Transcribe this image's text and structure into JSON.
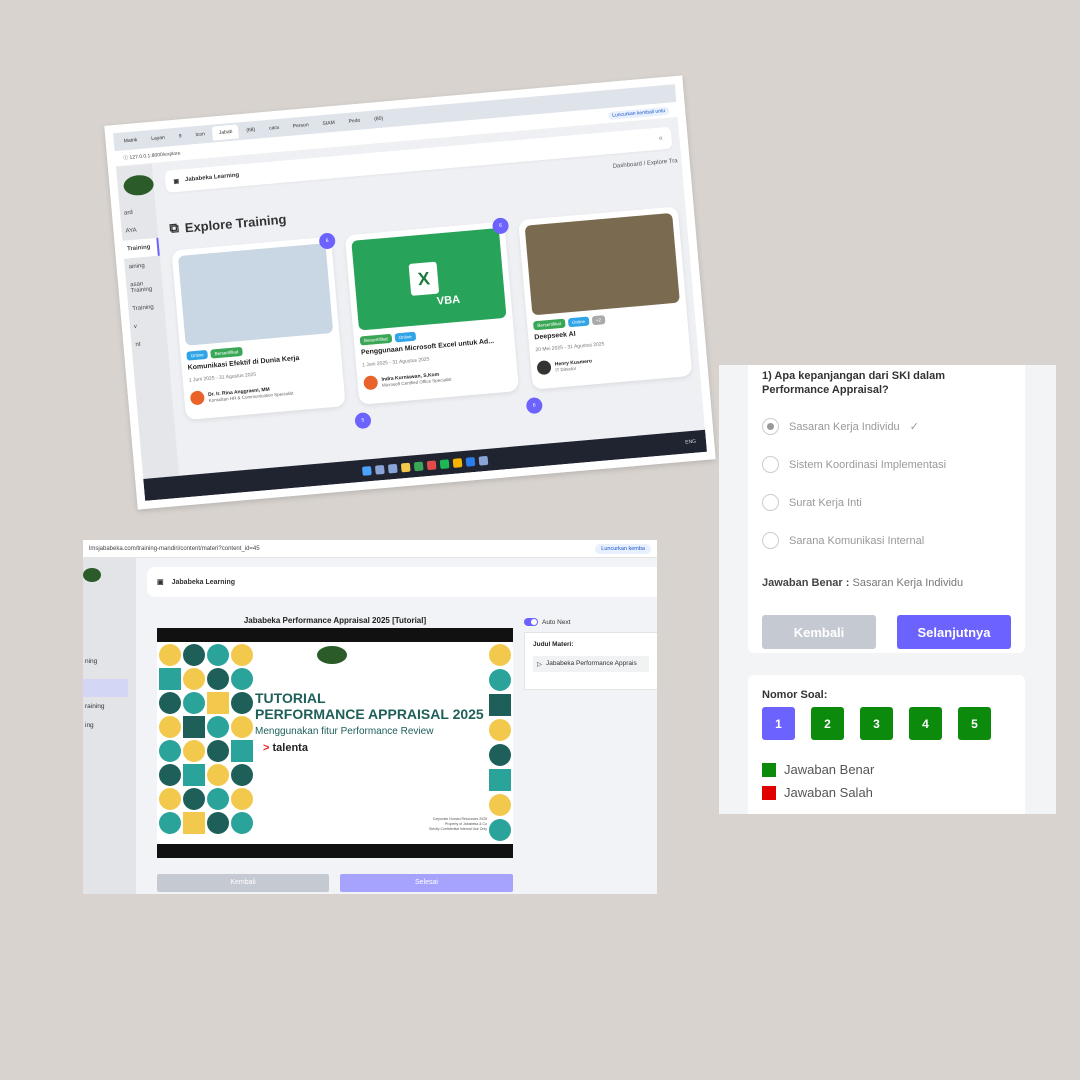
{
  "shot1": {
    "tabs": [
      "Matrik",
      "Layan",
      "9",
      "Icon",
      "Jabab",
      "(68)",
      "cara",
      "Person",
      "SIAM",
      "Pedo",
      "(80)"
    ],
    "url": "127.0.0.1:8000/explore",
    "brand": "Jababeka Learning",
    "breadcrumb": "Dashboard / Explore Tra",
    "page_title": "Explore Training",
    "sidebar": [
      "ard",
      "AYA",
      "Training",
      "aining",
      "asan Training",
      "Training",
      "v",
      "nt"
    ],
    "cards": [
      {
        "count": "6",
        "badges": [
          "Online",
          "Bersertifikat"
        ],
        "title": "Komunikasi Efektif di Dunia Kerja",
        "date": "1 Juni 2025 - 31 Agustus 2025",
        "instructor": "Dr. Ir. Rina Anggraeni, MM",
        "role": "Konsultan HR & Communication Specialist"
      },
      {
        "count": "6",
        "badges": [
          "Bersertifikat",
          "Online"
        ],
        "title": "Penggunaan Microsoft Excel untuk Ad...",
        "date": "1 Juni 2025 - 31 Agustus 2025",
        "instructor": "Indra Kurniawan, S.Kom",
        "role": "Microsoft Certified Office Specialist"
      },
      {
        "count": "",
        "badges": [
          "Bersertifikat",
          "Online",
          "+2"
        ],
        "title": "Deepseek AI",
        "date": "20 Mei 2025 - 31 Agustus 2025",
        "instructor": "Henry Kusmero",
        "role": "IT Director"
      }
    ],
    "extra_counts": [
      "5",
      "6"
    ],
    "thumb_text": "VBA",
    "excel_letter": "X",
    "tray": "ENG",
    "relaunch": "Luncurkan kembali untu"
  },
  "shot2": {
    "url": "lmsjababeka.com/training-mandiri/content/materi?content_id=45",
    "relaunch": "Luncurkan kemba",
    "brand": "Jababeka Learning",
    "sidebar": [
      "ning",
      "raining",
      "ing"
    ],
    "video_title": "Jababeka Performance Appraisal 2025 [Tutorial]",
    "slide_line1": "TUTORIAL",
    "slide_line2": "PERFORMANCE APPRAISAL 2025",
    "slide_sub": "Menggunakan fitur Performance Review",
    "slide_brand": "talenta",
    "slide_conf": [
      "Corporate Human Resources 2025",
      "Property of Jababeka & Co",
      "Strictly Confidential Internal Use Only"
    ],
    "auto_next": "Auto Next",
    "judul_label": "Judul Materi:",
    "judul_item": "Jababeka Performance Apprais",
    "btn_back": "Kembali",
    "btn_done": "Selesai"
  },
  "shot3": {
    "question": "1) Apa kepanjangan dari SKI dalam Performance Appraisal?",
    "options": [
      "Sasaran Kerja Individu",
      "Sistem Koordinasi Implementasi",
      "Surat Kerja Inti",
      "Sarana Komunikasi Internal"
    ],
    "answer_label": "Jawaban Benar :",
    "answer_value": "Sasaran Kerja Individu",
    "btn_back": "Kembali",
    "btn_next": "Selanjutnya",
    "nomor_label": "Nomor Soal:",
    "numbers": [
      "1",
      "2",
      "3",
      "4",
      "5"
    ],
    "legend_correct": "Jawaban Benar",
    "legend_wrong": "Jawaban Salah"
  },
  "colors": {
    "accent": "#6c63ff",
    "correct": "#0b8a0b",
    "wrong": "#e00000",
    "disabled": "#c5c9d2"
  }
}
